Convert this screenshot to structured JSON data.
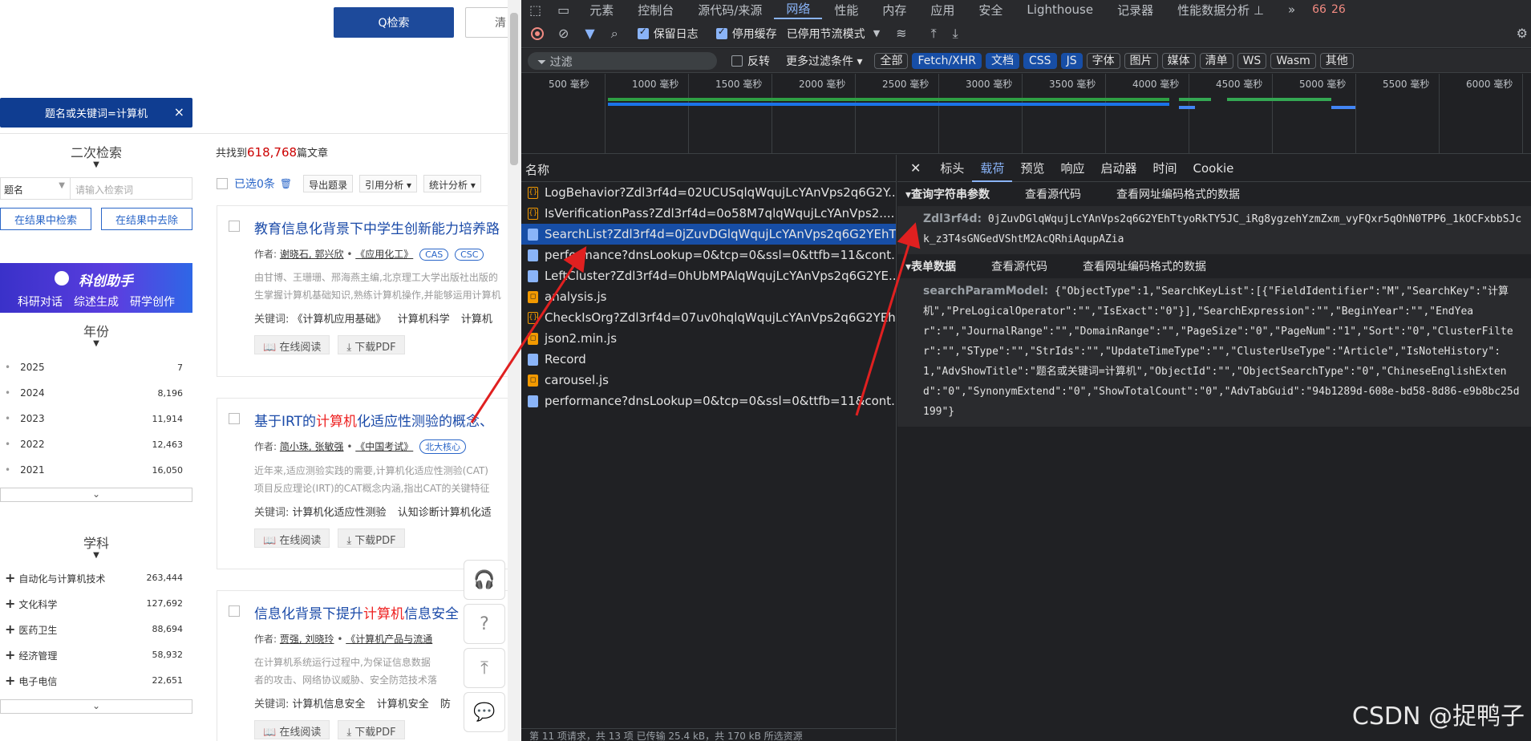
{
  "left": {
    "search_button": "Q检索",
    "clear_button": "清",
    "query_tag": "题名或关键词=计算机",
    "secondary": {
      "title": "二次检索",
      "field": "题名",
      "placeholder": "请输入检索词",
      "btn_within": "在结果中检索",
      "btn_exclude": "在结果中去除"
    },
    "kechuang": {
      "title": "科创助手",
      "links": [
        "科研对话",
        "综述生成",
        "研学创作"
      ]
    },
    "year": {
      "title": "年份",
      "rows": [
        {
          "label": "2025",
          "count": "7"
        },
        {
          "label": "2024",
          "count": "8,196"
        },
        {
          "label": "2023",
          "count": "11,914"
        },
        {
          "label": "2022",
          "count": "12,463"
        },
        {
          "label": "2021",
          "count": "16,050"
        }
      ]
    },
    "subject": {
      "title": "学科",
      "rows": [
        {
          "label": "自动化与计算机技术",
          "count": "263,444"
        },
        {
          "label": "文化科学",
          "count": "127,692"
        },
        {
          "label": "医药卫生",
          "count": "88,694"
        },
        {
          "label": "经济管理",
          "count": "58,932"
        },
        {
          "label": "电子电信",
          "count": "22,651"
        }
      ]
    },
    "results": {
      "prefix": "共找到",
      "count": "618,768",
      "suffix": "篇文章",
      "selected": "已选0条",
      "export": "导出题录",
      "cite": "引用分析 ▾",
      "stats": "统计分析 ▾"
    },
    "articles": [
      {
        "title_pre": "教育信息化背景下中学生创新能力培养路",
        "title_hl": "",
        "title_post": "",
        "authors_label": "作者:",
        "authors": "谢晓石, 郭兴欣",
        "journal": "《应用化工》",
        "badges": [
          "CAS",
          "CSC"
        ],
        "abstract": "由甘博、王珊珊、邢海燕主编,北京理工大学出版社出版的",
        "abstract2": "生掌握计算机基础知识,熟练计算机操作,并能够运用计算机",
        "kw_label": "关键词:",
        "keywords": [
          "《计算机应用基础》",
          "计算机科学",
          "计算机"
        ],
        "read": "在线阅读",
        "download": "下载PDF"
      },
      {
        "title_pre": "基于IRT的",
        "title_hl": "计算机",
        "title_post": "化适应性测验的概念、",
        "authors_label": "作者:",
        "authors": "简小珠, 张敏强",
        "journal": "《中国考试》",
        "badges": [
          "北大核心"
        ],
        "abstract": "近年来,适应测验实践的需要,计算机化适应性测验(CAT)",
        "abstract2": "项目反应理论(IRT)的CAT概念内涵,指出CAT的关键特征",
        "kw_label": "关键词:",
        "keywords": [
          "计算机化适应性测验",
          "认知诊断计算机化适"
        ],
        "read": "在线阅读",
        "download": "下载PDF"
      },
      {
        "title_pre": "信息化背景下提升",
        "title_hl": "计算机",
        "title_post": "信息安全",
        "authors_label": "作者:",
        "authors": "贾强, 刘晓玲",
        "journal": "《计算机产品与流通",
        "badges": [],
        "abstract": "在计算机系统运行过程中,为保证信息数据",
        "abstract2": "者的攻击、网络协议威胁、安全防范技术落",
        "kw_label": "关键词:",
        "keywords": [
          "计算机信息安全",
          "计算机安全",
          "防"
        ],
        "read": "在线阅读",
        "download": "下载PDF"
      }
    ]
  },
  "devtools": {
    "tabs": [
      "元素",
      "控制台",
      "源代码/来源",
      "网络",
      "性能",
      "内存",
      "应用",
      "安全",
      "Lighthouse",
      "记录器",
      "性能数据分析 ⊥",
      "»"
    ],
    "active_tab": "网络",
    "warnings": "66",
    "errors": "26",
    "toolbar": {
      "preserve_log": "保留日志",
      "disable_cache": "停用缓存",
      "throttle": "已停用节流模式"
    },
    "filter": {
      "placeholder": "过滤",
      "invert": "反转",
      "more": "更多过滤条件 ▾",
      "chips": [
        "全部",
        "Fetch/XHR",
        "文档",
        "CSS",
        "JS",
        "字体",
        "图片",
        "媒体",
        "清单",
        "WS",
        "Wasm",
        "其他"
      ],
      "active_chips": [
        "Fetch/XHR",
        "文档",
        "CSS",
        "JS"
      ]
    },
    "timeline_labels": [
      "500 毫秒",
      "1000 毫秒",
      "1500 毫秒",
      "2000 毫秒",
      "2500 毫秒",
      "3000 毫秒",
      "3500 毫秒",
      "4000 毫秒",
      "4500 毫秒",
      "5000 毫秒",
      "5500 毫秒",
      "6000 毫秒"
    ],
    "list_header": "名称",
    "requests": [
      {
        "name": "LogBehavior?Zdl3rf4d=02UCUSqlqWqujLcYAnVps2q6G2Y...",
        "type": "xhr"
      },
      {
        "name": "IsVerificationPass?Zdl3rf4d=0o58M7qlqWqujLcYAnVps2....",
        "type": "xhr"
      },
      {
        "name": "SearchList?Zdl3rf4d=0jZuvDGlqWqujLcYAnVps2q6G2YEhT...",
        "type": "doc"
      },
      {
        "name": "performance?dnsLookup=0&tcp=0&ssl=0&ttfb=11&cont...",
        "type": "doc"
      },
      {
        "name": "LeftCluster?Zdl3rf4d=0hUbMPAlqWqujLcYAnVps2q6G2YE...",
        "type": "doc"
      },
      {
        "name": "analysis.js",
        "type": "js"
      },
      {
        "name": "CheckIsOrg?Zdl3rf4d=07uv0hqlqWqujLcYAnVps2q6G2YEh...",
        "type": "xhr"
      },
      {
        "name": "json2.min.js",
        "type": "js"
      },
      {
        "name": "Record",
        "type": "doc"
      },
      {
        "name": "carousel.js",
        "type": "js"
      },
      {
        "name": "performance?dnsLookup=0&tcp=0&ssl=0&ttfb=11&cont...",
        "type": "doc"
      }
    ],
    "detail_tabs": [
      "标头",
      "载荷",
      "预览",
      "响应",
      "启动器",
      "时间",
      "Cookie"
    ],
    "active_detail_tab": "载荷",
    "query_section": {
      "title": "▾查询字符串参数",
      "view_source": "查看源代码",
      "view_encoded": "查看网址编码格式的数据",
      "key": "Zdl3rf4d:",
      "value": "0jZuvDGlqWqujLcYAnVps2q6G2YEhTtyoRkTY5JC_iRg8ygzehYzmZxm_vyFQxr5qOhN0TPP6_1kOCFxbbSJck_z3T4sGNGedVShtM2AcQRhiAqupAZia"
    },
    "form_section": {
      "title": "▾表单数据",
      "view_source": "查看源代码",
      "view_encoded": "查看网址编码格式的数据",
      "key": "searchParamModel:",
      "value": "{\"ObjectType\":1,\"SearchKeyList\":[{\"FieldIdentifier\":\"M\",\"SearchKey\":\"计算机\",\"PreLogicalOperator\":\"\",\"IsExact\":\"0\"}],\"SearchExpression\":\"\",\"BeginYear\":\"\",\"EndYear\":\"\",\"JournalRange\":\"\",\"DomainRange\":\"\",\"PageSize\":\"0\",\"PageNum\":\"1\",\"Sort\":\"0\",\"ClusterFilter\":\"\",\"SType\":\"\",\"StrIds\":\"\",\"UpdateTimeType\":\"\",\"ClusterUseType\":\"Article\",\"IsNoteHistory\":1,\"AdvShowTitle\":\"题名或关键词=计算机\",\"ObjectId\":\"\",\"ObjectSearchType\":\"0\",\"ChineseEnglishExtend\":\"0\",\"SynonymExtend\":\"0\",\"ShowTotalCount\":\"0\",\"AdvTabGuid\":\"94b1289d-608e-bd58-8d86-e9b8bc25d199\"}"
    },
    "footer": "第 11 项请求，共 13 项  已传输 25.4 kB，共 170 kB  所选资源"
  },
  "watermark": "CSDN @捉鸭子",
  "colors": {
    "accent": "#1d4a9b",
    "highlight": "#e22222",
    "devtools_bg": "#202124",
    "selected_row": "#174ea6",
    "arrow": "#e02020"
  }
}
